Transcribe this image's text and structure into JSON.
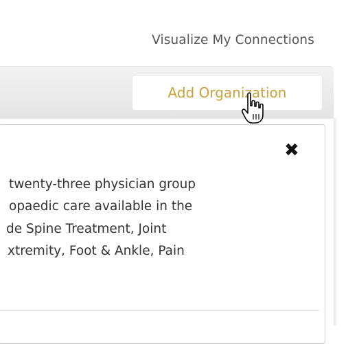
{
  "header": {
    "visualize_link": "Visualize My Connections",
    "add_org_button": "Add Organization"
  },
  "cursor": {
    "icon": "hand-pointer-icon"
  },
  "card": {
    "close_icon": "close-icon",
    "description_lines": [
      "twenty-three physician group",
      "opaedic care available in the",
      "de Spine Treatment, Joint",
      "xtremity, Foot & Ankle, Pain"
    ]
  },
  "colors": {
    "accent": "#c8a33a",
    "header_bg": "#e8e8e8",
    "text": "#333333"
  }
}
